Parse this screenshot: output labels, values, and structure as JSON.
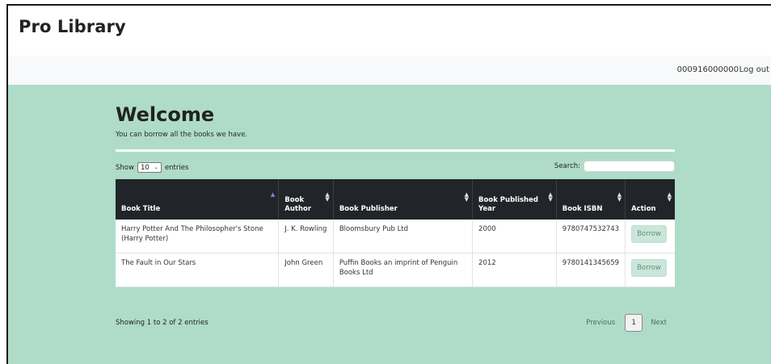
{
  "app": {
    "brand": "Pro Library"
  },
  "topbar": {
    "user_id": "000916000000",
    "logout_label": "Log out"
  },
  "page": {
    "title": "Welcome",
    "subtitle": "You can borrow all the books we have."
  },
  "controls": {
    "show_label": "Show",
    "entries_value": "10",
    "entries_label": "entries",
    "search_label": "Search:",
    "search_value": ""
  },
  "table": {
    "headers": [
      "Book Title",
      "Book Author",
      "Book Publisher",
      "Book Published Year",
      "Book ISBN",
      "Action"
    ],
    "rows": [
      {
        "title": "Harry Potter And The Philosopher's Stone (Harry Potter)",
        "author": "J. K. Rowling",
        "publisher": "Bloomsbury Pub Ltd",
        "year": "2000",
        "isbn": "9780747532743",
        "action": "Borrow"
      },
      {
        "title": "The Fault in Our Stars",
        "author": "John Green",
        "publisher": "Puffin Books an imprint of Penguin Books Ltd",
        "year": "2012",
        "isbn": "9780141345659",
        "action": "Borrow"
      }
    ]
  },
  "footer": {
    "info": "Showing 1 to 2 of 2 entries",
    "previous_label": "Previous",
    "current_page": "1",
    "next_label": "Next"
  },
  "colors": {
    "main_background": "#aedcc9",
    "header_background": "#212529",
    "borrow_button": "#c8e6d9"
  }
}
